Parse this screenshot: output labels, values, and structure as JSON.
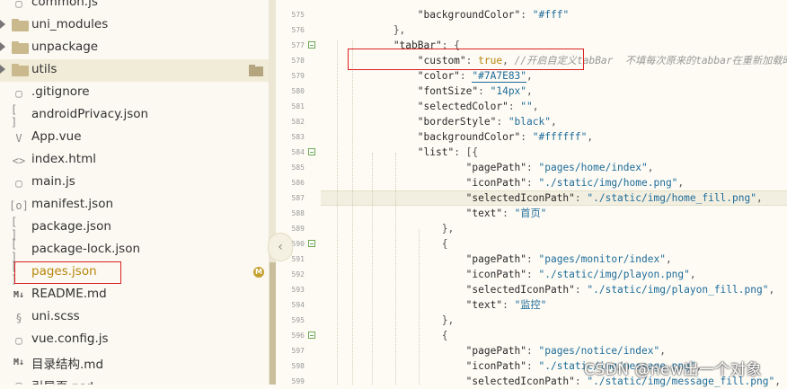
{
  "sidebar": {
    "items": [
      {
        "type": "file",
        "icon": "file-icon",
        "label": "common.js"
      },
      {
        "type": "folder",
        "icon": "folder-icon",
        "label": "uni_modules"
      },
      {
        "type": "folder",
        "icon": "folder-icon",
        "label": "unpackage"
      },
      {
        "type": "folder",
        "icon": "folder-icon",
        "label": "utils"
      },
      {
        "type": "file",
        "icon": "file-icon",
        "label": ".gitignore"
      },
      {
        "type": "file",
        "icon": "json-icon",
        "label": "androidPrivacy.json"
      },
      {
        "type": "file",
        "icon": "vue-icon",
        "label": "App.vue"
      },
      {
        "type": "file",
        "icon": "html-icon",
        "label": "index.html"
      },
      {
        "type": "file",
        "icon": "file-icon",
        "label": "main.js"
      },
      {
        "type": "file",
        "icon": "manifest-icon",
        "label": "manifest.json"
      },
      {
        "type": "file",
        "icon": "json-icon",
        "label": "package.json"
      },
      {
        "type": "file",
        "icon": "json-icon",
        "label": "package-lock.json"
      },
      {
        "type": "file",
        "icon": "json-icon",
        "label": "pages.json",
        "badge": "M"
      },
      {
        "type": "file",
        "icon": "markdown-icon",
        "label": "README.md"
      },
      {
        "type": "file",
        "icon": "scss-icon",
        "label": "uni.scss"
      },
      {
        "type": "file",
        "icon": "file-icon",
        "label": "vue.config.js"
      },
      {
        "type": "file",
        "icon": "markdown-icon",
        "label": "目录结构.md"
      },
      {
        "type": "file",
        "icon": "file-icon",
        "label": "引导页.psd"
      }
    ],
    "collapse_glyph": "‹"
  },
  "icon_glyphs": {
    "file-icon": "▢",
    "json-icon": "[ ]",
    "vue-icon": "V",
    "html-icon": "<>",
    "manifest-icon": "[o]",
    "markdown-icon": "M↓",
    "scss-icon": "§"
  },
  "editor": {
    "line_numbers": [
      "575",
      "576",
      "577",
      "578",
      "579",
      "580",
      "581",
      "582",
      "583",
      "584",
      "585",
      "586",
      "587",
      "588",
      "589",
      "590",
      "591",
      "592",
      "593",
      "594",
      "595",
      "596",
      "597",
      "598",
      "599"
    ],
    "fold_lines": [
      "577",
      "584",
      "590",
      "596"
    ],
    "lines": [
      [
        {
          "t": "                \"backgroundColor\"",
          "c": "key"
        },
        {
          "t": ": ",
          "c": "punc"
        },
        {
          "t": "\"#fff\"",
          "c": "str"
        }
      ],
      [
        {
          "t": "            },",
          "c": "punc"
        }
      ],
      [
        {
          "t": "            \"tabBar\"",
          "c": "key"
        },
        {
          "t": ": {",
          "c": "punc"
        }
      ],
      [
        {
          "t": "                \"custom\"",
          "c": "key"
        },
        {
          "t": ": ",
          "c": "punc"
        },
        {
          "t": "true",
          "c": "bool"
        },
        {
          "t": ", ",
          "c": "punc"
        },
        {
          "t": "//开启自定义tabBar",
          "c": "cmt"
        },
        {
          "t": "  不填每次原来的tabbar在重新加载时都回",
          "c": "cmt"
        }
      ],
      [
        {
          "t": "                \"color\"",
          "c": "key"
        },
        {
          "t": ": ",
          "c": "punc"
        },
        {
          "t": "\"#7A7E83\"",
          "c": "str"
        },
        {
          "t": ",",
          "c": "punc"
        }
      ],
      [
        {
          "t": "                \"fontSize\"",
          "c": "key"
        },
        {
          "t": ": ",
          "c": "punc"
        },
        {
          "t": "\"14px\"",
          "c": "str"
        },
        {
          "t": ",",
          "c": "punc"
        }
      ],
      [
        {
          "t": "                \"selectedColor\"",
          "c": "key"
        },
        {
          "t": ": ",
          "c": "punc"
        },
        {
          "t": "\"\"",
          "c": "str"
        },
        {
          "t": ",",
          "c": "punc"
        }
      ],
      [
        {
          "t": "                \"borderStyle\"",
          "c": "key"
        },
        {
          "t": ": ",
          "c": "punc"
        },
        {
          "t": "\"black\"",
          "c": "str"
        },
        {
          "t": ",",
          "c": "punc"
        }
      ],
      [
        {
          "t": "                \"backgroundColor\"",
          "c": "key"
        },
        {
          "t": ": ",
          "c": "punc"
        },
        {
          "t": "\"#ffffff\"",
          "c": "str"
        },
        {
          "t": ",",
          "c": "punc"
        }
      ],
      [
        {
          "t": "                \"list\"",
          "c": "key"
        },
        {
          "t": ": [{",
          "c": "punc"
        }
      ],
      [
        {
          "t": "                        \"pagePath\"",
          "c": "key"
        },
        {
          "t": ": ",
          "c": "punc"
        },
        {
          "t": "\"pages/home/index\"",
          "c": "str"
        },
        {
          "t": ",",
          "c": "punc"
        }
      ],
      [
        {
          "t": "                        \"iconPath\"",
          "c": "key"
        },
        {
          "t": ": ",
          "c": "punc"
        },
        {
          "t": "\"./static/img/home.png\"",
          "c": "str"
        },
        {
          "t": ",",
          "c": "punc"
        }
      ],
      [
        {
          "t": "                        \"selectedIconPath\"",
          "c": "key"
        },
        {
          "t": ": ",
          "c": "punc"
        },
        {
          "t": "\"./static/img/home_fill.png\"",
          "c": "str"
        },
        {
          "t": ",",
          "c": "punc"
        }
      ],
      [
        {
          "t": "                        \"text\"",
          "c": "key"
        },
        {
          "t": ": ",
          "c": "punc"
        },
        {
          "t": "\"首页\"",
          "c": "str"
        }
      ],
      [
        {
          "t": "                    },",
          "c": "punc"
        }
      ],
      [
        {
          "t": "                    {",
          "c": "punc"
        }
      ],
      [
        {
          "t": "                        \"pagePath\"",
          "c": "key"
        },
        {
          "t": ": ",
          "c": "punc"
        },
        {
          "t": "\"pages/monitor/index\"",
          "c": "str"
        },
        {
          "t": ",",
          "c": "punc"
        }
      ],
      [
        {
          "t": "                        \"iconPath\"",
          "c": "key"
        },
        {
          "t": ": ",
          "c": "punc"
        },
        {
          "t": "\"./static/img/playon.png\"",
          "c": "str"
        },
        {
          "t": ",",
          "c": "punc"
        }
      ],
      [
        {
          "t": "                        \"selectedIconPath\"",
          "c": "key"
        },
        {
          "t": ": ",
          "c": "punc"
        },
        {
          "t": "\"./static/img/playon_fill.png\"",
          "c": "str"
        },
        {
          "t": ",",
          "c": "punc"
        }
      ],
      [
        {
          "t": "                        \"text\"",
          "c": "key"
        },
        {
          "t": ": ",
          "c": "punc"
        },
        {
          "t": "\"监控\"",
          "c": "str"
        }
      ],
      [
        {
          "t": "                    },",
          "c": "punc"
        }
      ],
      [
        {
          "t": "                    {",
          "c": "punc"
        }
      ],
      [
        {
          "t": "                        \"pagePath\"",
          "c": "key"
        },
        {
          "t": ": ",
          "c": "punc"
        },
        {
          "t": "\"pages/notice/index\"",
          "c": "str"
        },
        {
          "t": ",",
          "c": "punc"
        }
      ],
      [
        {
          "t": "                        \"iconPath\"",
          "c": "key"
        },
        {
          "t": ": ",
          "c": "punc"
        },
        {
          "t": "\"./static/img/message.png\"",
          "c": "str"
        },
        {
          "t": ",",
          "c": "punc"
        }
      ],
      [
        {
          "t": "                        \"selectedIconPath\"",
          "c": "key"
        },
        {
          "t": ": ",
          "c": "punc"
        },
        {
          "t": "\"./static/img/message_fill.png\"",
          "c": "str"
        },
        {
          "t": ",",
          "c": "punc"
        }
      ]
    ]
  },
  "watermark": "CSDN @new出一个对象",
  "colors": {
    "accent_red": "#dd2222",
    "string_blue": "#1e6c9a",
    "bool_gold": "#b8860b",
    "badge_gold": "#c4a02e"
  }
}
